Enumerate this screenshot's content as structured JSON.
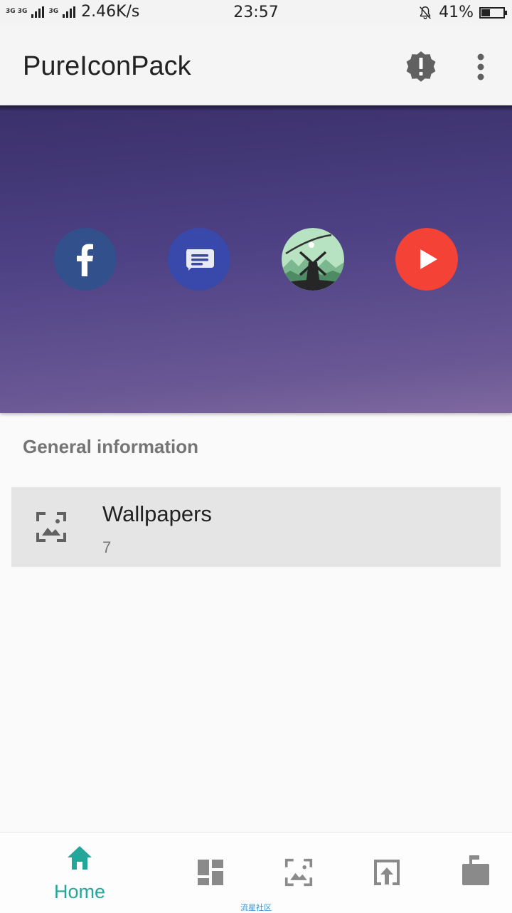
{
  "status_bar": {
    "signal_label_1": "3G 3G",
    "signal_label_2": "3G",
    "speed": "2.46K/s",
    "time": "23:57",
    "battery": "41%",
    "battery_level": 0.41,
    "icons": [
      "signal-icon",
      "silent-bell-icon",
      "battery-icon"
    ]
  },
  "app_bar": {
    "title": "PureIconPack",
    "actions": [
      {
        "icon": "alert-badge-icon"
      },
      {
        "icon": "more-vertical-icon"
      }
    ]
  },
  "header": {
    "featured_icons": [
      {
        "icon": "facebook-icon",
        "color": "#3b5998"
      },
      {
        "icon": "messages-icon",
        "color": "#3949ab"
      },
      {
        "icon": "alto-game-icon",
        "color": "#a8d8b0"
      },
      {
        "icon": "youtube-icon",
        "color": "#f44336"
      }
    ]
  },
  "section": {
    "title": "General information"
  },
  "wallpapers": {
    "title": "Wallpapers",
    "count": "7",
    "icon": "wallpaper-icon"
  },
  "bottom_nav": {
    "items": [
      {
        "label": "Home",
        "icon": "home-icon",
        "active": true
      },
      {
        "icon": "dashboard-icon"
      },
      {
        "icon": "wallpaper-icon"
      },
      {
        "icon": "apply-icon"
      },
      {
        "icon": "request-icon"
      }
    ],
    "accent": "#26a69a",
    "inactive": "#8a8a8a"
  },
  "watermark": "流星社区"
}
